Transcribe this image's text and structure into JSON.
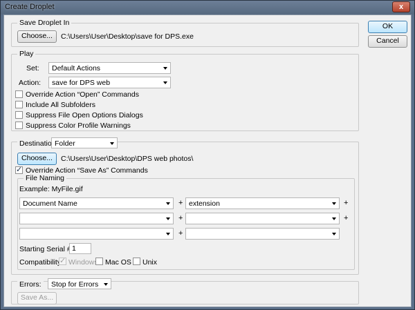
{
  "window": {
    "title": "Create Droplet",
    "close_glyph": "x"
  },
  "actions": {
    "ok": "OK",
    "cancel": "Cancel"
  },
  "save_droplet": {
    "legend": "Save Droplet In",
    "choose": "Choose...",
    "path": "C:\\Users\\User\\Desktop\\save for DPS.exe"
  },
  "play": {
    "legend": "Play",
    "set_label": "Set:",
    "set_value": "Default Actions",
    "action_label": "Action:",
    "action_value": "save for DPS web",
    "options": [
      {
        "label": "Override Action “Open” Commands",
        "checked": false
      },
      {
        "label": "Include All Subfolders",
        "checked": false
      },
      {
        "label": "Suppress File Open Options Dialogs",
        "checked": false
      },
      {
        "label": "Suppress Color Profile Warnings",
        "checked": false
      }
    ]
  },
  "destination": {
    "label": "Destination:",
    "value": "Folder",
    "choose": "Choose...",
    "path": "C:\\Users\\User\\Desktop\\DPS web photos\\",
    "override_label": "Override Action “Save As” Commands",
    "override_checked": true,
    "file_naming": {
      "legend": "File Naming",
      "example": "Example: MyFile.gif",
      "rows": [
        {
          "left": "Document Name",
          "right": "extension"
        },
        {
          "left": "",
          "right": ""
        },
        {
          "left": "",
          "right": ""
        }
      ],
      "plus": "+",
      "serial_label": "Starting Serial #:",
      "serial_value": "1",
      "compat_label": "Compatibility:",
      "compat": [
        {
          "label": "Windows",
          "checked": true,
          "disabled": true
        },
        {
          "label": "Mac OS",
          "checked": false,
          "disabled": false
        },
        {
          "label": "Unix",
          "checked": false,
          "disabled": false
        }
      ]
    }
  },
  "errors": {
    "label": "Errors:",
    "value": "Stop for Errors",
    "save_as": "Save As..."
  }
}
